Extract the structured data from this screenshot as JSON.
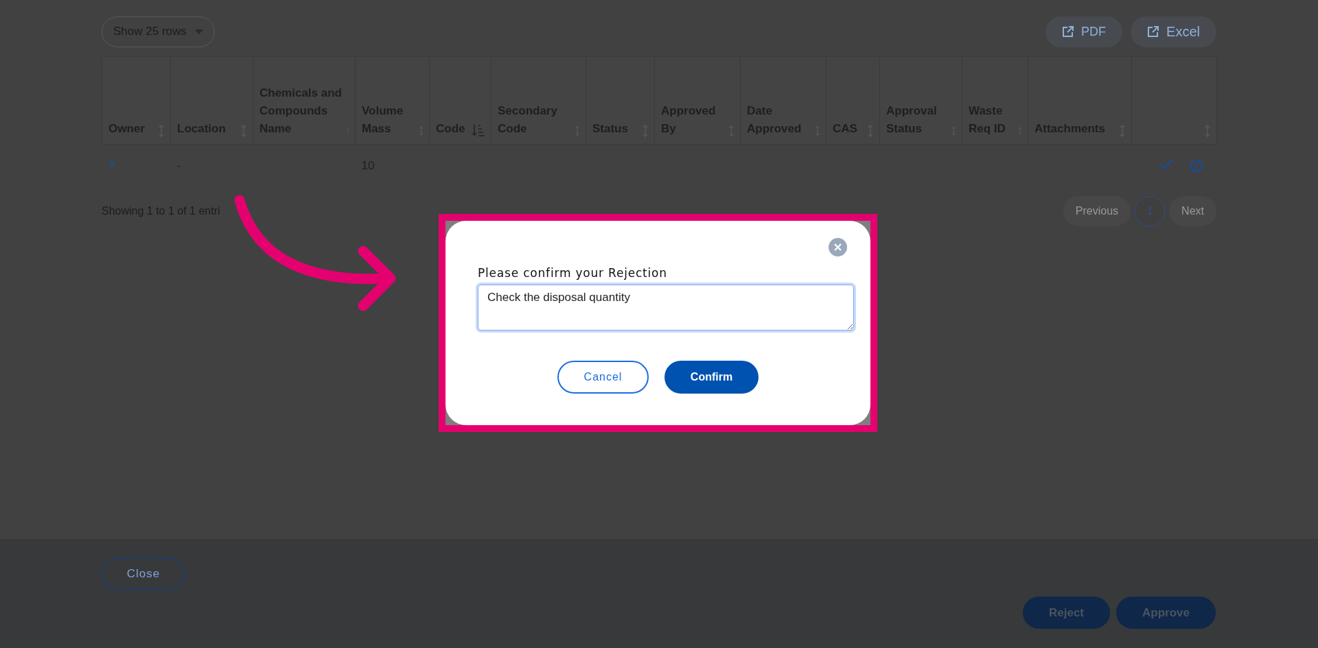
{
  "toolbar": {
    "rows_select": "Show 25 rows",
    "export_buttons": [
      "PDF",
      "Excel"
    ]
  },
  "table": {
    "columns": [
      {
        "label": "Owner",
        "sorted_descending": false
      },
      {
        "label": "Location",
        "sorted_descending": false
      },
      {
        "label": "Chemicals and Compounds Name",
        "sorted_descending": false
      },
      {
        "label": "Volume Mass",
        "sorted_descending": false
      },
      {
        "label": "Code",
        "sorted_descending": true
      },
      {
        "label": "Secondary Code",
        "sorted_descending": false
      },
      {
        "label": "Status",
        "sorted_descending": false
      },
      {
        "label": "Approved By",
        "sorted_descending": false
      },
      {
        "label": "Date Approved",
        "sorted_descending": false
      },
      {
        "label": "CAS",
        "sorted_descending": false
      },
      {
        "label": "Approval Status",
        "sorted_descending": false
      },
      {
        "label": "Waste Req ID",
        "sorted_descending": false
      },
      {
        "label": "Attachments",
        "sorted_descending": false
      },
      {
        "sorted_descending": false
      }
    ],
    "rows": [
      {
        "expanded": false,
        "cells": [
          null,
          "-",
          null,
          "10",
          null,
          null,
          null,
          null,
          null,
          null,
          null,
          null,
          null,
          null
        ]
      }
    ]
  },
  "pagination": {
    "summary": "Showing 1 to 1 of 1 entri",
    "previous": {
      "label": "Previous",
      "disabled": true
    },
    "pages": [
      {
        "label": "1",
        "selected": true
      }
    ],
    "next": {
      "label": "Next",
      "disabled": true
    }
  },
  "modal": {
    "title": "Please confirm your Rejection",
    "comment": "Check the disposal quantity",
    "buttons": [
      {
        "label": "Cancel",
        "kind": "secondary"
      },
      {
        "label": "Confirm",
        "kind": "primary"
      }
    ]
  },
  "footer": {
    "close": "Close",
    "actions": [
      "Reject",
      "Approve"
    ]
  }
}
